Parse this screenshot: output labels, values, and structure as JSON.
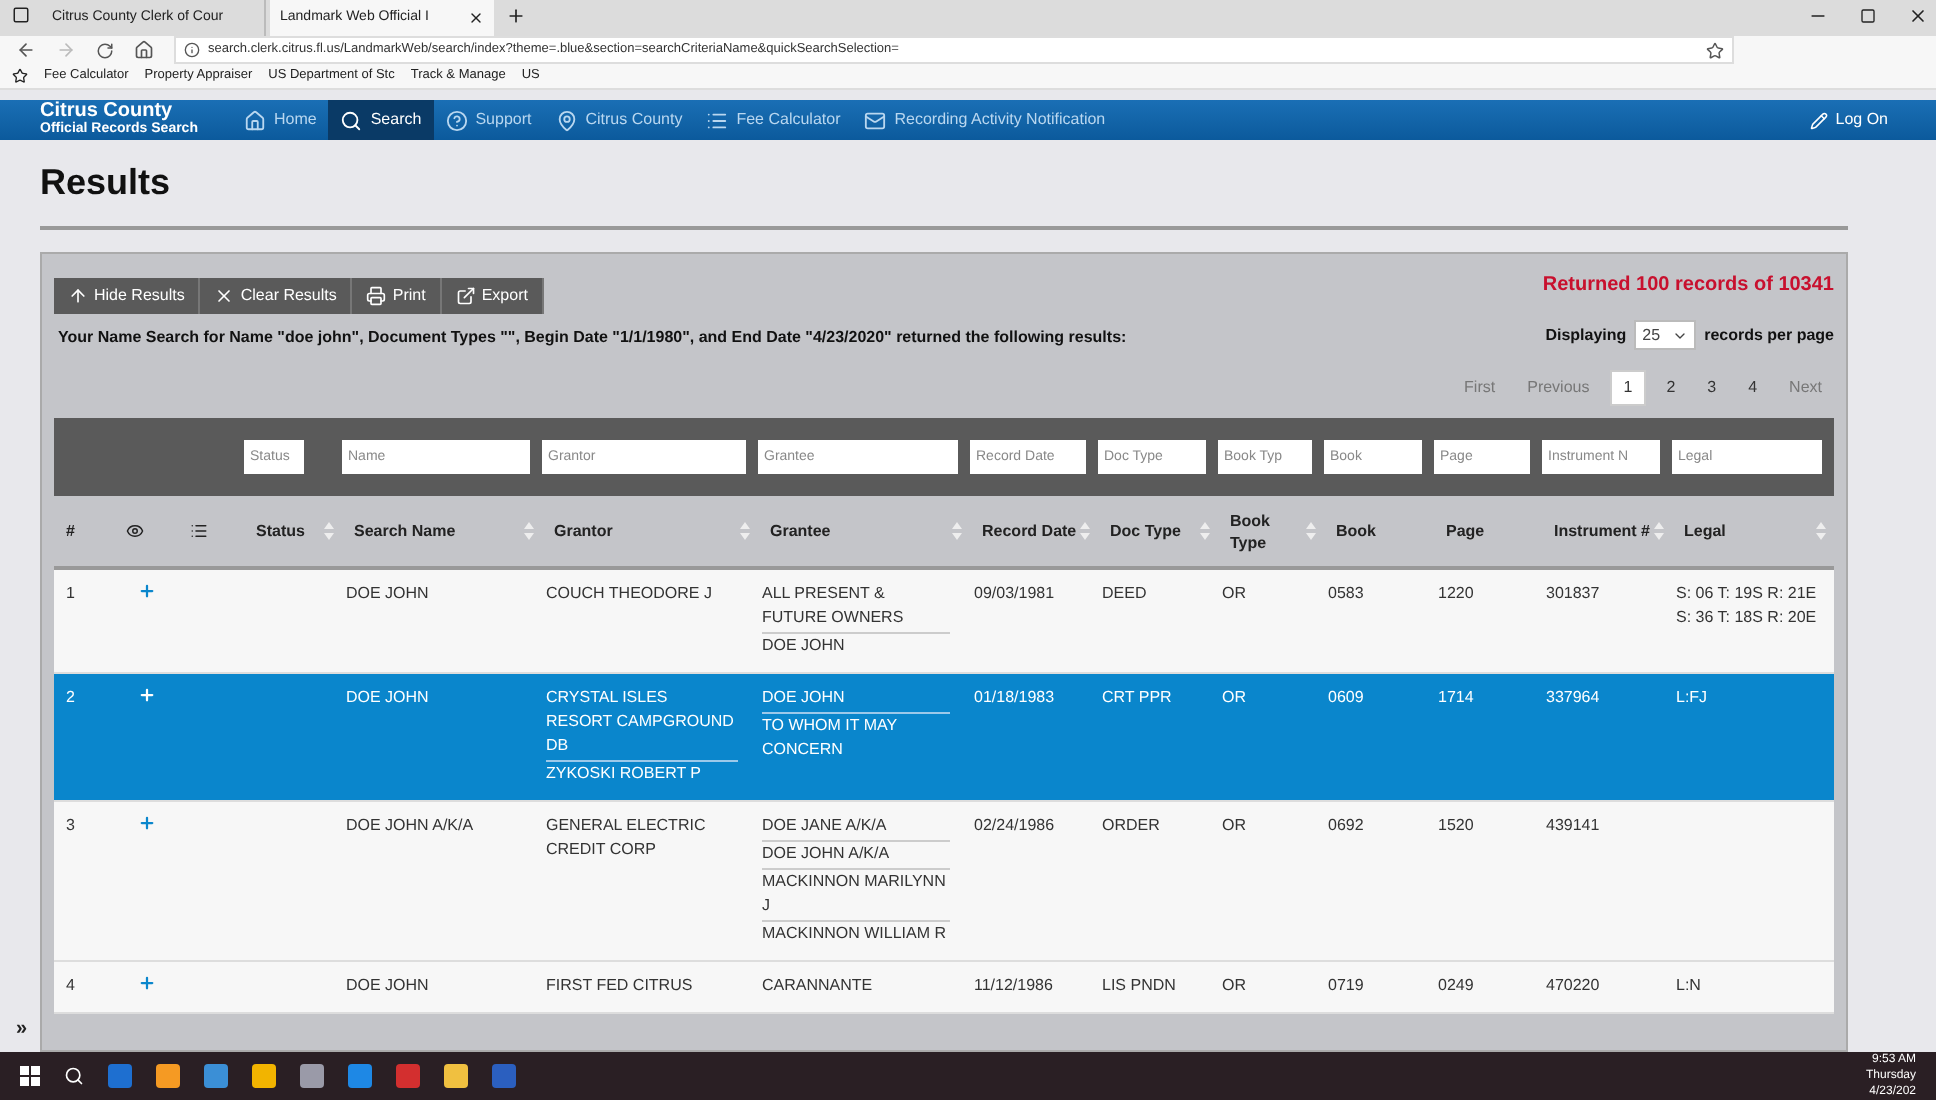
{
  "browser": {
    "tabs": [
      {
        "title": "Citrus County Clerk of Cour",
        "selected": false
      },
      {
        "title": "Landmark Web Official I",
        "selected": true
      }
    ],
    "url": "search.clerk.citrus.fl.us/LandmarkWeb/search/index?theme=.blue&section=searchCriteriaName&quickSearchSelection=",
    "bookmarks": [
      "Fee Calculator",
      "Property Appraiser",
      "US Department of Stc",
      "Track & Manage",
      "US"
    ]
  },
  "nav": {
    "brand": "Citrus County",
    "brand_sub": "Official Records Search",
    "items": [
      {
        "label": "Home",
        "selected": false
      },
      {
        "label": "Search",
        "selected": true
      },
      {
        "label": "Support",
        "selected": false
      },
      {
        "label": "Citrus County",
        "selected": false
      },
      {
        "label": "Fee Calculator",
        "selected": false
      },
      {
        "label": "Recording Activity Notification",
        "selected": false
      }
    ],
    "log_on": "Log On"
  },
  "page": {
    "heading": "Results",
    "actions": [
      {
        "label": "Hide Results"
      },
      {
        "label": "Clear Results"
      },
      {
        "label": "Print"
      },
      {
        "label": "Export"
      }
    ],
    "returned": "Returned 100 records of 10341",
    "summary": "Your Name Search for Name \"doe john\", Document Types \"\", Begin Date \"1/1/1980\", and End Date \"4/23/2020\" returned the following results:",
    "displaying": "Displaying",
    "per_page": "25",
    "per_page_suffix": "records per page",
    "pagination": [
      {
        "label": "First",
        "selected": false
      },
      {
        "label": "Previous",
        "selected": false
      },
      {
        "label": "1",
        "selected": true
      },
      {
        "label": "2",
        "selected": false
      },
      {
        "label": "3",
        "selected": false
      },
      {
        "label": "4",
        "selected": false
      },
      {
        "label": "Next",
        "selected": false
      }
    ],
    "side_toggle": "»"
  },
  "table": {
    "filters": [
      {
        "placeholder": "Status"
      },
      {
        "placeholder": "Name"
      },
      {
        "placeholder": "Grantor"
      },
      {
        "placeholder": "Grantee"
      },
      {
        "placeholder": "Record Date"
      },
      {
        "placeholder": "Doc Type"
      },
      {
        "placeholder": "Book Typ"
      },
      {
        "placeholder": "Book"
      },
      {
        "placeholder": "Page"
      },
      {
        "placeholder": "Instrument N"
      },
      {
        "placeholder": "Legal"
      }
    ],
    "columns": [
      {
        "label": "#",
        "kind": "text",
        "sortable": false
      },
      {
        "kind": "eye"
      },
      {
        "kind": "list"
      },
      {
        "label": "Status",
        "kind": "text",
        "sortable": true
      },
      {
        "label": "Search Name",
        "kind": "text",
        "sortable": true
      },
      {
        "label": "Grantor",
        "kind": "text",
        "sortable": true
      },
      {
        "label": "Grantee",
        "kind": "text",
        "sortable": true
      },
      {
        "label": "Record Date",
        "kind": "text",
        "sortable": true
      },
      {
        "label": "Doc Type",
        "kind": "text",
        "sortable": true
      },
      {
        "label": "Book Type",
        "kind": "text",
        "sortable": true
      },
      {
        "label": "Book",
        "kind": "text",
        "sortable": false
      },
      {
        "label": "Page",
        "kind": "text",
        "sortable": false
      },
      {
        "label": "Instrument #",
        "kind": "text",
        "sortable": true
      },
      {
        "label": "Legal",
        "kind": "text",
        "sortable": true
      }
    ],
    "rows": [
      {
        "num": "1",
        "selected": false,
        "search_name": "DOE JOHN",
        "grantor": [
          "COUCH THEODORE J"
        ],
        "grantee": [
          "ALL PRESENT & FUTURE OWNERS",
          "DOE JOHN"
        ],
        "record_date": "09/03/1981",
        "doc_type": "DEED",
        "book_type": "OR",
        "book": "0583",
        "page": "1220",
        "instrument": "301837",
        "legal": "S: 06 T: 19S R: 21E S: 36 T: 18S R: 20E"
      },
      {
        "num": "2",
        "selected": true,
        "search_name": "DOE JOHN",
        "grantor": [
          "CRYSTAL ISLES RESORT CAMPGROUND DB",
          "ZYKOSKI ROBERT P"
        ],
        "grantee": [
          "DOE JOHN",
          "TO WHOM IT MAY CONCERN"
        ],
        "record_date": "01/18/1983",
        "doc_type": "CRT PPR",
        "book_type": "OR",
        "book": "0609",
        "page": "1714",
        "instrument": "337964",
        "legal": "L:FJ"
      },
      {
        "num": "3",
        "selected": false,
        "search_name": "DOE JOHN A/K/A",
        "grantor": [
          "GENERAL ELECTRIC CREDIT CORP"
        ],
        "grantee": [
          "DOE JANE A/K/A",
          "DOE JOHN A/K/A",
          "MACKINNON MARILYNN J",
          "MACKINNON WILLIAM R"
        ],
        "record_date": "02/24/1986",
        "doc_type": "ORDER",
        "book_type": "OR",
        "book": "0692",
        "page": "1520",
        "instrument": "439141"
      },
      {
        "num": "4",
        "selected": false,
        "search_name": "DOE JOHN",
        "grantor": [
          "FIRST FED CITRUS"
        ],
        "grantee": [
          "CARANNANTE"
        ],
        "record_date": "11/12/1986",
        "doc_type": "LIS PNDN",
        "book_type": "OR",
        "book": "0719",
        "page": "0249",
        "instrument": "470220",
        "legal": "L:N"
      }
    ]
  },
  "taskbar": {
    "time": "9:53 AM",
    "day": "Thursday",
    "date": "4/23/202"
  }
}
